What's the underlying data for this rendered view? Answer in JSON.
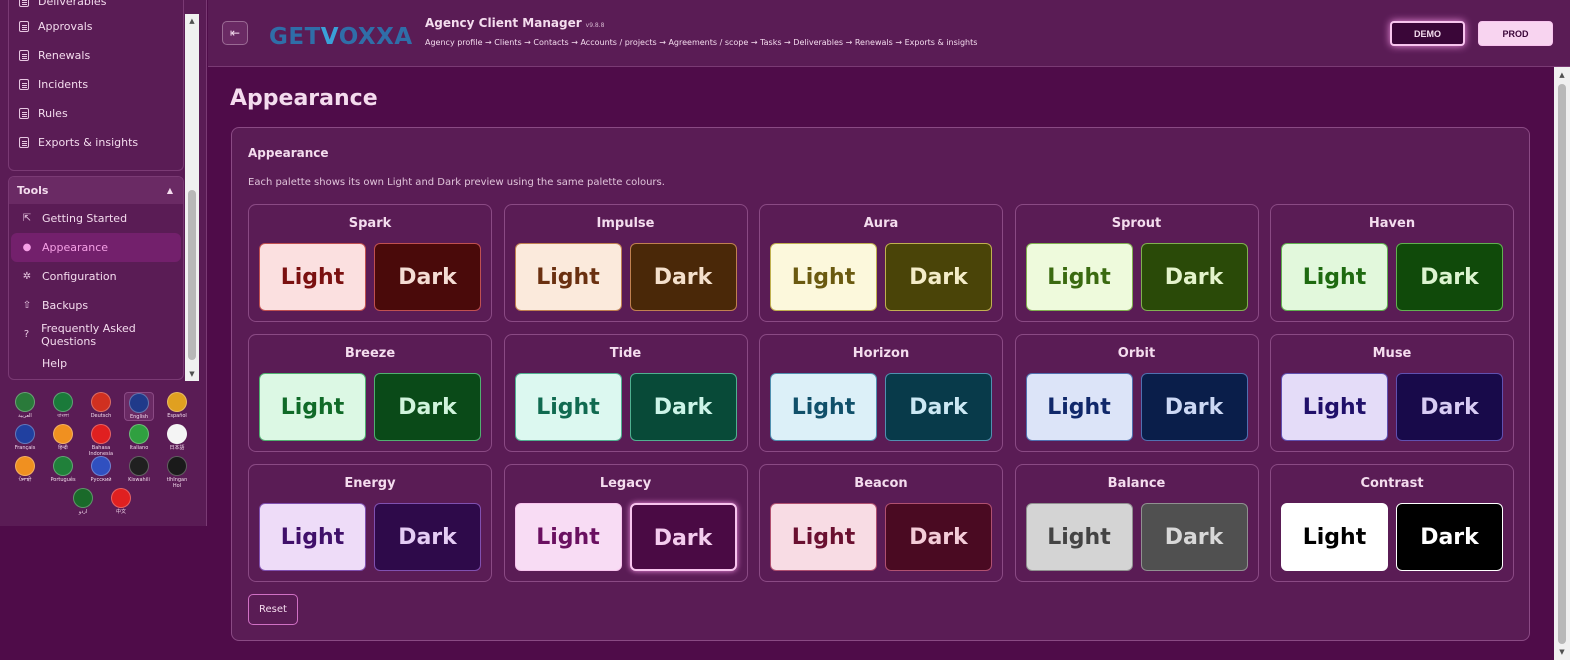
{
  "sidebar": {
    "top_items": [
      {
        "label": "Deliverables",
        "icon": "document-icon"
      },
      {
        "label": "Approvals",
        "icon": "document-icon"
      },
      {
        "label": "Renewals",
        "icon": "document-icon"
      },
      {
        "label": "Incidents",
        "icon": "document-icon"
      },
      {
        "label": "Rules",
        "icon": "document-icon"
      },
      {
        "label": "Exports & insights",
        "icon": "document-icon"
      }
    ],
    "tools": {
      "label": "Tools",
      "items": [
        {
          "label": "Getting Started",
          "icon": "rocket-icon"
        },
        {
          "label": "Appearance",
          "icon": "palette-icon"
        },
        {
          "label": "Configuration",
          "icon": "gear-icon"
        },
        {
          "label": "Backups",
          "icon": "upload-icon"
        },
        {
          "label": "Frequently Asked Questions",
          "icon": "help-icon"
        },
        {
          "label": "Help",
          "icon": "none"
        }
      ]
    },
    "languages": [
      {
        "label": "العربية",
        "flag": "#2a7a3a"
      },
      {
        "label": "বাংলা",
        "flag": "#1a7a3a"
      },
      {
        "label": "Deutsch",
        "flag": "#d03020"
      },
      {
        "label": "English",
        "flag": "#203a8a"
      },
      {
        "label": "Español",
        "flag": "#e0a020"
      },
      {
        "label": "Français",
        "flag": "#2040a0"
      },
      {
        "label": "हिन्दी",
        "flag": "#f09020"
      },
      {
        "label": "Bahasa Indonesia",
        "flag": "#e02020"
      },
      {
        "label": "Italiano",
        "flag": "#30a040"
      },
      {
        "label": "日本語",
        "flag": "#f4f4f4"
      },
      {
        "label": "ਪੰਜਾਬੀ",
        "flag": "#f09020"
      },
      {
        "label": "Português",
        "flag": "#20803a"
      },
      {
        "label": "Русский",
        "flag": "#3050c0"
      },
      {
        "label": "Kiswahili",
        "flag": "#202020"
      },
      {
        "label": "tlhIngan Hol",
        "flag": "#1a1a1a"
      },
      {
        "label": "اردو",
        "flag": "#1a6a2a"
      },
      {
        "label": "中文",
        "flag": "#e02020"
      }
    ]
  },
  "header": {
    "logo_text_a": "GET",
    "logo_text_b": "V",
    "logo_text_c": "OXXA",
    "title": "Agency Client Manager",
    "version": "v9.8.8",
    "breadcrumbs": "Agency profile → Clients → Contacts → Accounts / projects → Agreements / scope → Tasks → Deliverables → Renewals → Exports & insights",
    "demo_label": "DEMO",
    "prod_label": "PROD"
  },
  "main": {
    "page_title": "Appearance",
    "card_title": "Appearance",
    "card_desc": "Each palette shows its own Light and Dark preview using the same palette colours.",
    "light_label": "Light",
    "dark_label": "Dark",
    "reset_label": "Reset",
    "palettes": [
      {
        "name": "Spark",
        "light_bg": "#fbe0e0",
        "light_fg": "#7a1010",
        "dark_bg": "#4a0a0a",
        "dark_fg": "#f4dcd4",
        "border": "#c05050"
      },
      {
        "name": "Impulse",
        "light_bg": "#fbeadc",
        "light_fg": "#6a3010",
        "dark_bg": "#4a2808",
        "dark_fg": "#f4e0cc",
        "border": "#c08050"
      },
      {
        "name": "Aura",
        "light_bg": "#fcf8dc",
        "light_fg": "#6a5a10",
        "dark_bg": "#4a4408",
        "dark_fg": "#f4ecc8",
        "border": "#c0b050"
      },
      {
        "name": "Sprout",
        "light_bg": "#eefadc",
        "light_fg": "#3a6a10",
        "dark_bg": "#2a4a08",
        "dark_fg": "#e4f4cc",
        "border": "#80b050"
      },
      {
        "name": "Haven",
        "light_bg": "#e2f8dc",
        "light_fg": "#1e6a10",
        "dark_bg": "#104a0a",
        "dark_fg": "#dcf4d0",
        "border": "#60b050"
      },
      {
        "name": "Breeze",
        "light_bg": "#dcf8e4",
        "light_fg": "#106a28",
        "dark_bg": "#0a4a18",
        "dark_fg": "#d0f4dc",
        "border": "#50b070"
      },
      {
        "name": "Tide",
        "light_bg": "#dcf8f0",
        "light_fg": "#106a50",
        "dark_bg": "#084a38",
        "dark_fg": "#ccf4e8",
        "border": "#50b090"
      },
      {
        "name": "Horizon",
        "light_bg": "#dcf0f8",
        "light_fg": "#10506a",
        "dark_bg": "#083a4a",
        "dark_fg": "#cce8f4",
        "border": "#5090b0"
      },
      {
        "name": "Orbit",
        "light_bg": "#dce4f8",
        "light_fg": "#10286a",
        "dark_bg": "#0a1e4a",
        "dark_fg": "#ccd8f4",
        "border": "#5070b0"
      },
      {
        "name": "Muse",
        "light_bg": "#e4dcf8",
        "light_fg": "#20106a",
        "dark_bg": "#180a4a",
        "dark_fg": "#d8ccf4",
        "border": "#6050b0"
      },
      {
        "name": "Energy",
        "light_bg": "#eedcf8",
        "light_fg": "#40106a",
        "dark_bg": "#2e0a4a",
        "dark_fg": "#e4ccf4",
        "border": "#8050b0"
      },
      {
        "name": "Legacy",
        "light_bg": "#f8dcf4",
        "light_fg": "#6a1060",
        "dark_bg": "#4a0a44",
        "dark_fg": "#f4ccee",
        "border": "#f8c4ee"
      },
      {
        "name": "Beacon",
        "light_bg": "#f8dce4",
        "light_fg": "#6a1030",
        "dark_bg": "#4a0a22",
        "dark_fg": "#f4ccd8",
        "border": "#b05070"
      },
      {
        "name": "Balance",
        "light_bg": "#d4d4d4",
        "light_fg": "#444444",
        "dark_bg": "#505050",
        "dark_fg": "#d8d8d8",
        "border": "#909090"
      },
      {
        "name": "Contrast",
        "light_bg": "#ffffff",
        "light_fg": "#000000",
        "dark_bg": "#000000",
        "dark_fg": "#ffffff",
        "border": "#ffffff"
      }
    ]
  }
}
